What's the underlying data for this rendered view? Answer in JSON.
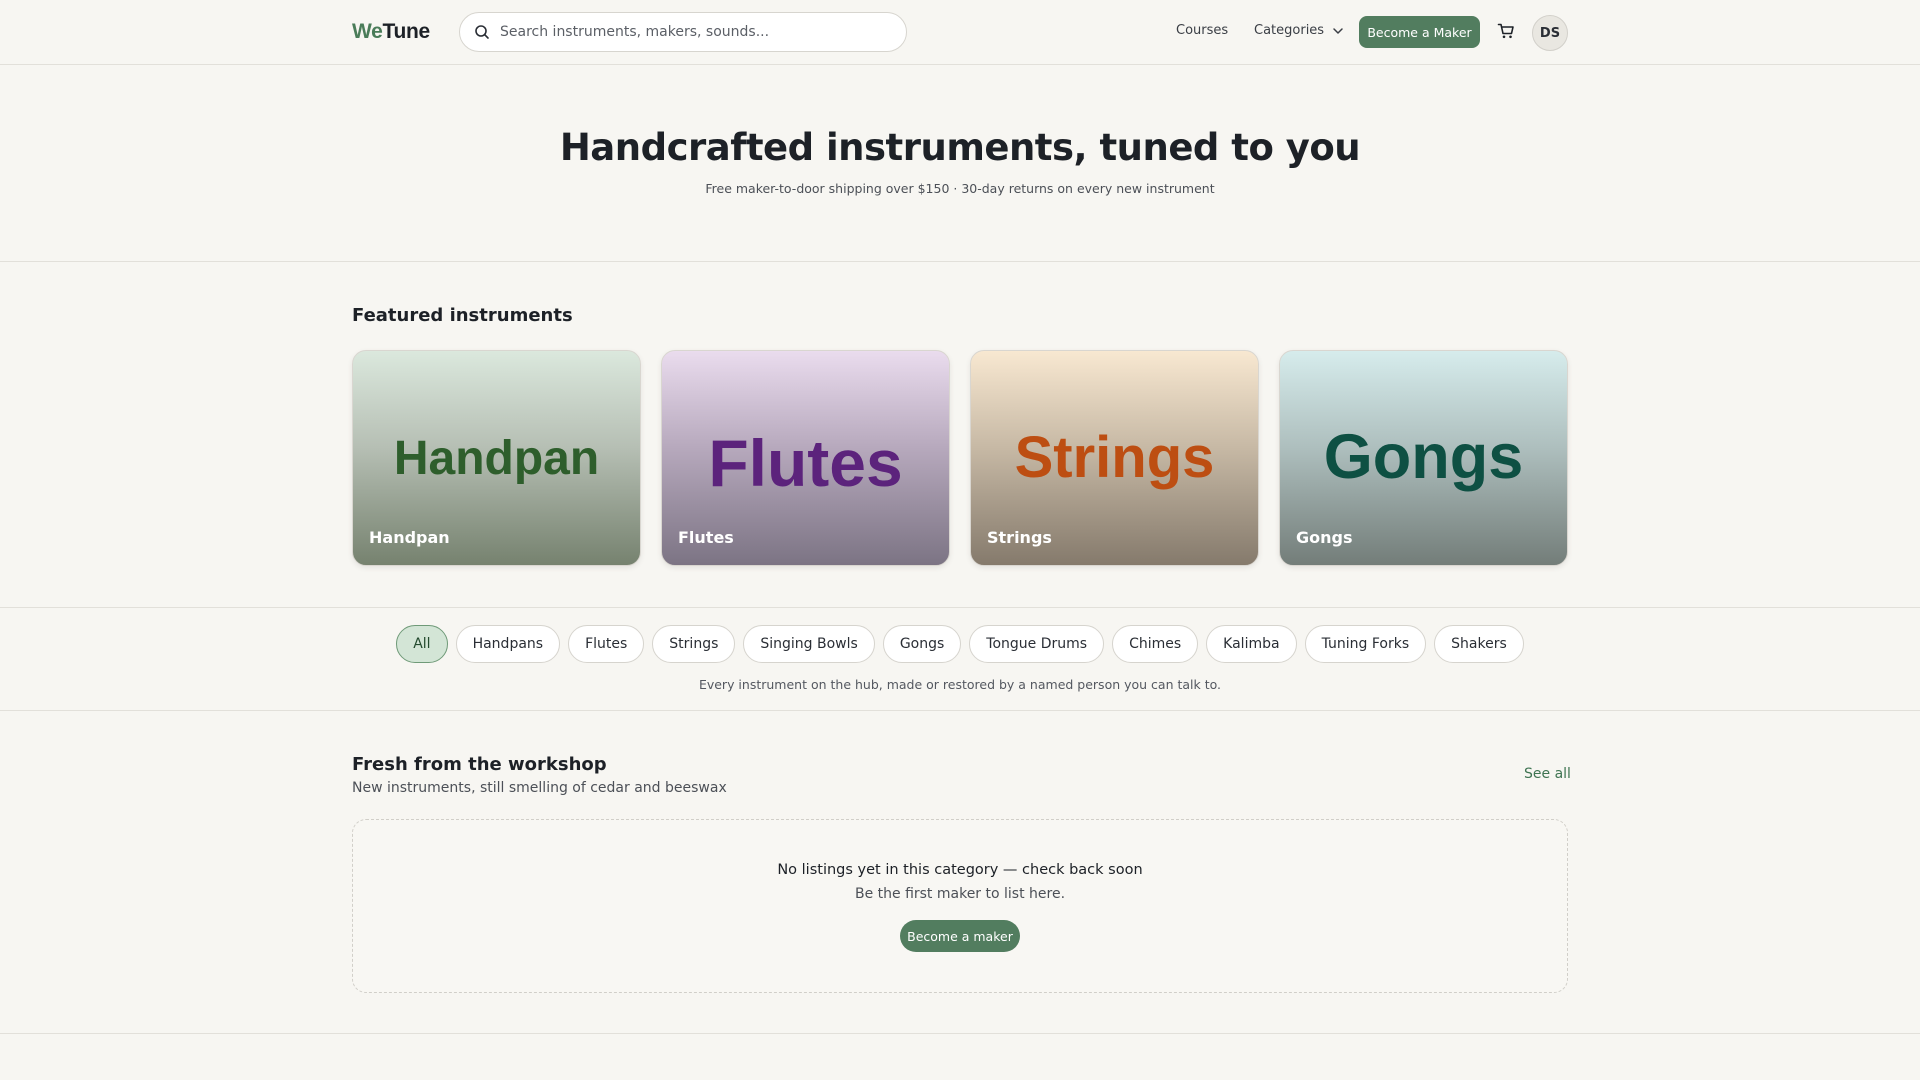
{
  "header": {
    "logo_we": "We",
    "logo_tune": "Tune",
    "search_placeholder": "Search instruments, makers, sounds...",
    "nav_courses": "Courses",
    "nav_categories": "Categories",
    "become_maker": "Become a Maker",
    "avatar_initials": "DS",
    "icons": [
      "search-icon",
      "chevron-down-icon",
      "cart-icon"
    ]
  },
  "hero": {
    "title": "Handcrafted instruments, tuned to you",
    "subtitle": "Free maker-to-door shipping over $150 · 30-day returns on every new instrument"
  },
  "featured": {
    "title": "Featured instruments",
    "cards": [
      {
        "art_text": "Handpan",
        "label": "Handpan"
      },
      {
        "art_text": "Flutes",
        "label": "Flutes"
      },
      {
        "art_text": "Strings",
        "label": "Strings"
      },
      {
        "art_text": "Gongs",
        "label": "Gongs"
      }
    ]
  },
  "categories": {
    "chips": [
      "All",
      "Handpans",
      "Flutes",
      "Strings",
      "Singing Bowls",
      "Gongs",
      "Tongue Drums",
      "Chimes",
      "Kalimba",
      "Tuning Forks",
      "Shakers"
    ],
    "selected": "All",
    "note": "Every instrument on the hub, made or restored by a named person you can talk to."
  },
  "fresh": {
    "title": "Fresh from the workshop",
    "subtitle": "New instruments, still smelling of cedar and beeswax",
    "see_all": "See all",
    "empty_title": "No listings yet in this category — check back soon",
    "empty_sub": "Be the first maker to list here.",
    "empty_button": "Become a maker"
  },
  "colors": {
    "accent": "#527d5f",
    "background": "#f7f6f2",
    "chip_active": "#d3e5d6"
  }
}
